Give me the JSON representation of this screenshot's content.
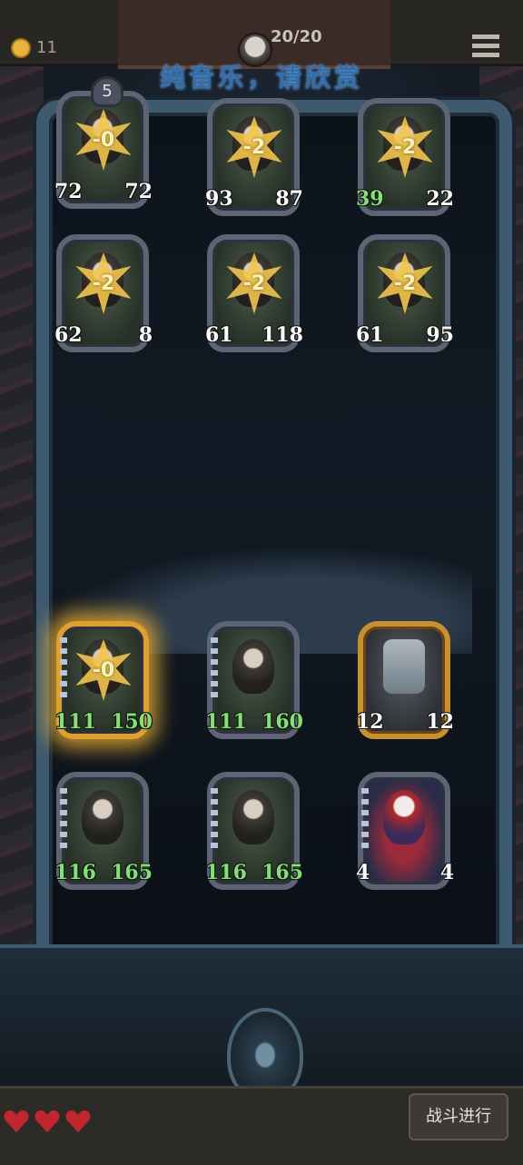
{
  "topbar": {
    "coins": "11",
    "round_counter": "20/20",
    "banner": "纯音乐，请欣赏",
    "coin_icon": "crown-coin-icon",
    "menu_icon": "hamburger-menu-icon"
  },
  "enemy_cards": [
    {
      "atk": "72",
      "hp": "72",
      "modifier": "-0",
      "level": "5"
    },
    {
      "atk": "93",
      "hp": "87",
      "modifier": "-2"
    },
    {
      "atk": "39",
      "hp": "22",
      "modifier": "-2"
    },
    {
      "atk": "62",
      "hp": "8",
      "modifier": "-2"
    },
    {
      "atk": "61",
      "hp": "118",
      "modifier": "-2"
    },
    {
      "atk": "61",
      "hp": "95",
      "modifier": "-2"
    }
  ],
  "player_cards": [
    {
      "atk": "111",
      "hp": "150",
      "modifier": "-0"
    },
    {
      "atk": "111",
      "hp": "160"
    },
    {
      "atk": "12",
      "hp": "12"
    },
    {
      "atk": "116",
      "hp": "165"
    },
    {
      "atk": "116",
      "hp": "165"
    },
    {
      "atk": "4",
      "hp": "4"
    }
  ],
  "bottombar": {
    "fight_button": "战斗进行",
    "lives": 3
  },
  "colors": {
    "hp_buff": "#7ee36f",
    "hp_badge": "#b3272c",
    "atk_badge": "#3d6580",
    "gold_glow": "#f7ba35"
  }
}
